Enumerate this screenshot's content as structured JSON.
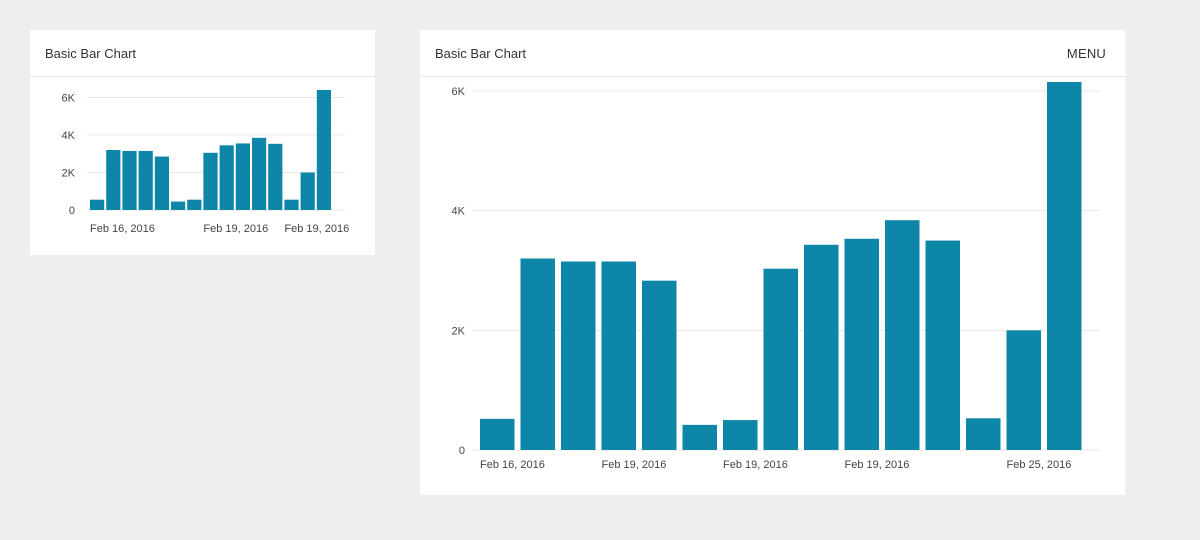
{
  "colors": {
    "bar": "#0e86a8",
    "grid": "#e8e8e8",
    "background": "#eeeeee"
  },
  "cards": {
    "small": {
      "title": "Basic Bar Chart"
    },
    "large": {
      "title": "Basic Bar Chart",
      "menu_label": "MENU"
    }
  },
  "chart_data": [
    {
      "type": "bar",
      "title": "Basic Bar Chart",
      "values": [
        550,
        3200,
        3150,
        3150,
        2850,
        450,
        550,
        3050,
        3450,
        3550,
        3850,
        3530,
        550,
        2000,
        6400
      ],
      "yticks": [
        {
          "value": 0,
          "label": "0"
        },
        {
          "value": 2000,
          "label": "2K"
        },
        {
          "value": 4000,
          "label": "4K"
        },
        {
          "value": 6000,
          "label": "6K"
        }
      ],
      "xlabels": [
        {
          "index": 0,
          "label": "Feb 16, 2016"
        },
        {
          "index": 7,
          "label": "Feb 19, 2016"
        },
        {
          "index": 12,
          "label": "Feb 19, 2016"
        }
      ],
      "ylim": [
        0,
        6400
      ],
      "grid": true
    },
    {
      "type": "bar",
      "title": "Basic Bar Chart",
      "values": [
        520,
        3200,
        3150,
        3150,
        2830,
        420,
        500,
        3030,
        3430,
        3530,
        3840,
        3500,
        530,
        2000,
        6150
      ],
      "yticks": [
        {
          "value": 0,
          "label": "0"
        },
        {
          "value": 2000,
          "label": "2K"
        },
        {
          "value": 4000,
          "label": "4K"
        },
        {
          "value": 6000,
          "label": "6K"
        }
      ],
      "xlabels": [
        {
          "index": 0,
          "label": "Feb 16, 2016"
        },
        {
          "index": 3,
          "label": "Feb 19, 2016"
        },
        {
          "index": 6,
          "label": "Feb 19, 2016"
        },
        {
          "index": 9,
          "label": "Feb 19, 2016"
        },
        {
          "index": 13,
          "label": "Feb 25, 2016"
        }
      ],
      "ylim": [
        0,
        6150
      ],
      "grid": true
    }
  ]
}
